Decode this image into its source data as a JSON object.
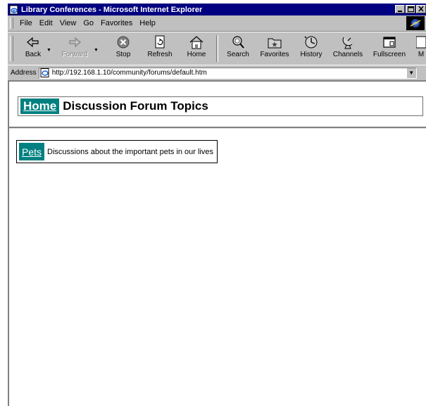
{
  "window": {
    "title": "Library Conferences - Microsoft Internet Explorer"
  },
  "menu": [
    {
      "label": "File"
    },
    {
      "label": "Edit"
    },
    {
      "label": "View"
    },
    {
      "label": "Go"
    },
    {
      "label": "Favorites"
    },
    {
      "label": "Help"
    }
  ],
  "toolbar": {
    "back": "Back",
    "forward": "Forward",
    "stop": "Stop",
    "refresh": "Refresh",
    "home": "Home",
    "search": "Search",
    "favorites": "Favorites",
    "history": "History",
    "channels": "Channels",
    "fullscreen": "Fullscreen",
    "more": "M"
  },
  "address": {
    "label": "Address",
    "url": "http://192.168.1.10/community/forums/default.htm"
  },
  "page": {
    "home_link": "Home",
    "title": "Discussion Forum Topics",
    "topics": [
      {
        "name": "Pets",
        "description": "Discussions about the important pets in our lives"
      }
    ]
  },
  "colors": {
    "titlebar": "#000080",
    "chrome": "#c0c0c0",
    "link_bg": "#008080"
  }
}
